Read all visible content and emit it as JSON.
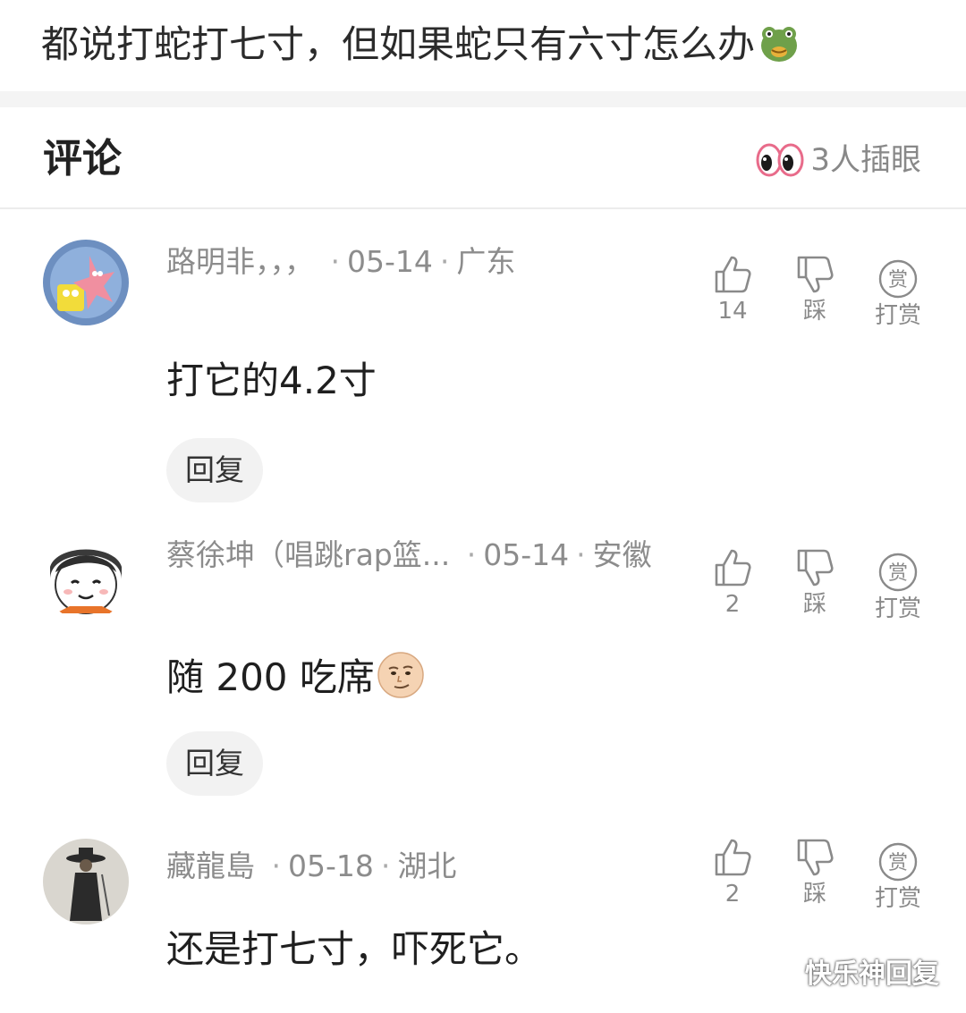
{
  "post": {
    "text": "都说打蛇打七寸，但如果蛇只有六寸怎么办",
    "emoji_icon": "frog-face-icon"
  },
  "comments_header": {
    "title": "评论",
    "peek_icon": "eyes-icon",
    "peek_text": "3人插眼"
  },
  "comments": [
    {
      "username": "路明非，，，",
      "date": "05-14",
      "region": "广东",
      "text": "打它的4.2寸",
      "like_count": "14",
      "dislike_label": "踩",
      "tip_label": "打赏",
      "reply_label": "回复",
      "avatar": "patrick-spongebob-avatar"
    },
    {
      "username": "蔡徐坤（唱跳rap篮...",
      "date": "05-14",
      "region": "安徽",
      "text": "随 200 吃席",
      "sticker": "smirk-face-sticker",
      "like_count": "2",
      "dislike_label": "踩",
      "tip_label": "打赏",
      "reply_label": "回复",
      "avatar": "cartoon-boy-avatar"
    },
    {
      "username": "藏龍島",
      "date": "05-18",
      "region": "湖北",
      "text": "还是打七寸，吓死它。",
      "like_count": "2",
      "dislike_label": "踩",
      "tip_label": "打赏",
      "avatar": "swordsman-avatar"
    }
  ],
  "tip_icon_char": "赏",
  "watermark": {
    "icon": "wechat-icon",
    "text": "快乐神回复"
  },
  "colors": {
    "text_primary": "#1f1f1f",
    "text_secondary": "#8c8c8c",
    "reply_bg": "#f2f2f2",
    "divider": "#f4f4f4"
  }
}
